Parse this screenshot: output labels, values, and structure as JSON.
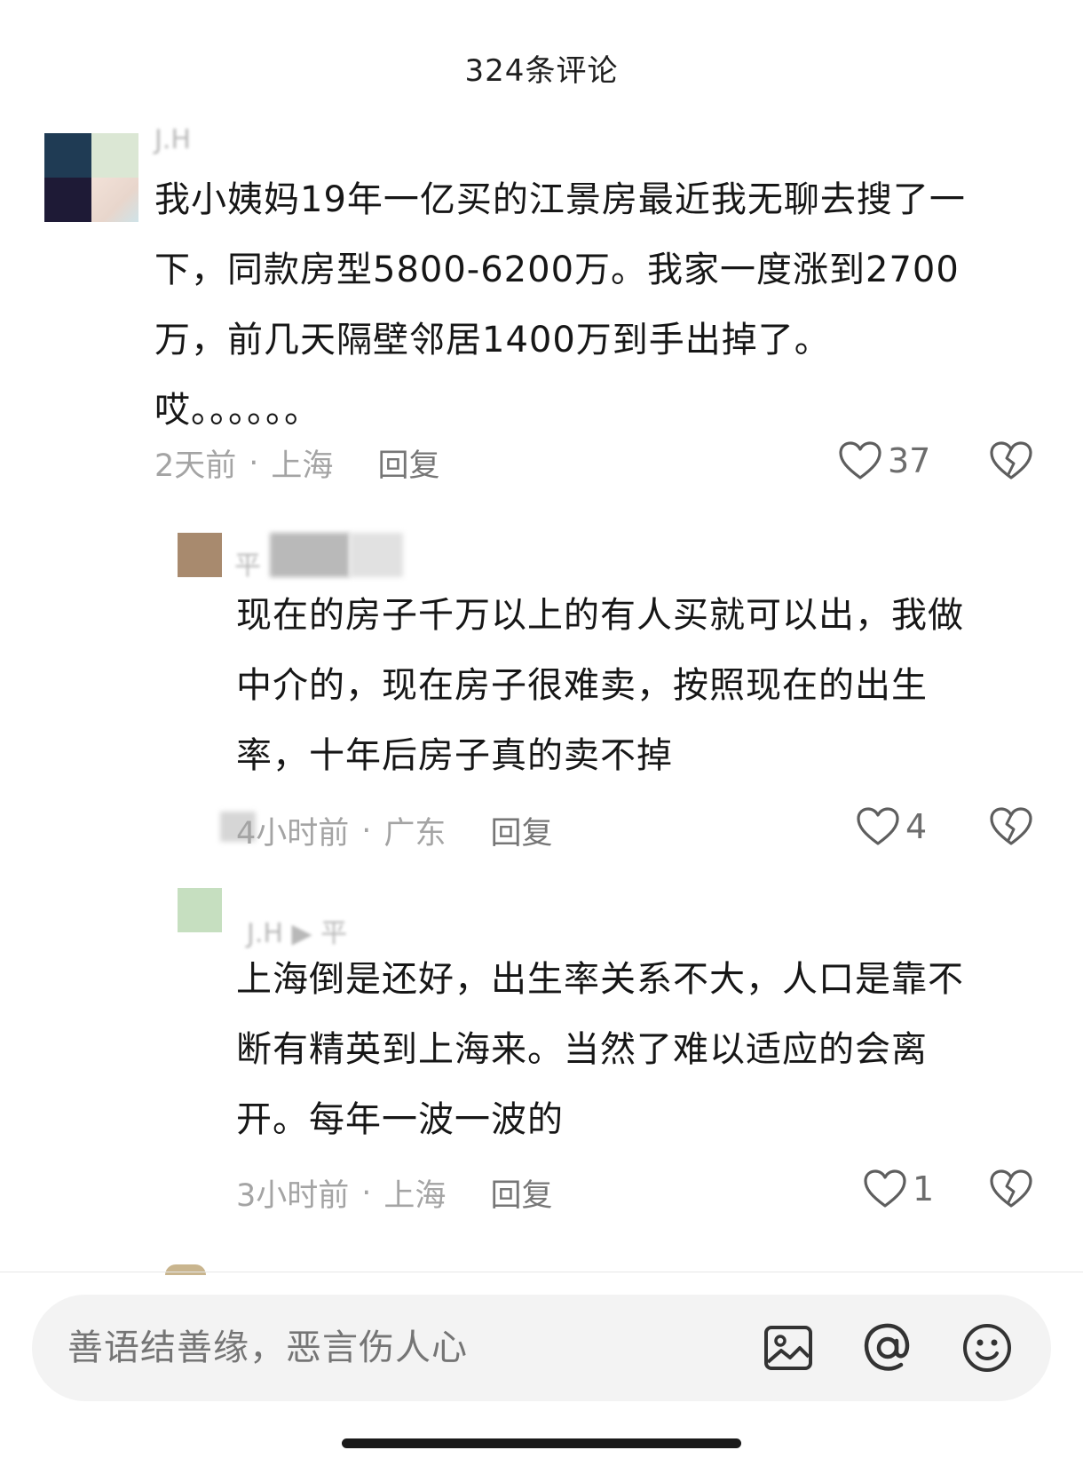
{
  "header": {
    "title": "324条评论"
  },
  "comments": [
    {
      "username": "J.H",
      "text": "我小姨妈19年一亿买的江景房最近我无聊去搜了一\n下，同款房型5800-6200万。我家一度涨到2700\n万，前几天隔壁邻居1400万到手出掉了。\n哎。。。。。。",
      "time": "2天前",
      "location": "上海",
      "reply_label": "回复",
      "likes": "37"
    },
    {
      "username": "平",
      "text": "现在的房子千万以上的有人买就可以出，我做\n中介的，现在房子很难卖，按照现在的出生\n率，十年后房子真的卖不掉",
      "time": "4小时前",
      "location": "广东",
      "reply_label": "回复",
      "likes": "4"
    },
    {
      "username": "J.H ▶ 平",
      "text": "上海倒是还好，出生率关系不大，人口是靠不\n断有精英到上海来。当然了难以适应的会离\n开。每年一波一波的",
      "time": "3小时前",
      "location": "上海",
      "reply_label": "回复",
      "likes": "1"
    }
  ],
  "input": {
    "placeholder": "善语结善缘，恶言伤人心"
  },
  "icons": {
    "like": "heart-icon",
    "dislike": "broken-heart-icon",
    "image": "image-icon",
    "mention": "at-icon",
    "emoji": "emoji-icon"
  },
  "colors": {
    "text": "#161616",
    "meta": "#a4a4a4",
    "input_bg": "#f3f3f3"
  }
}
